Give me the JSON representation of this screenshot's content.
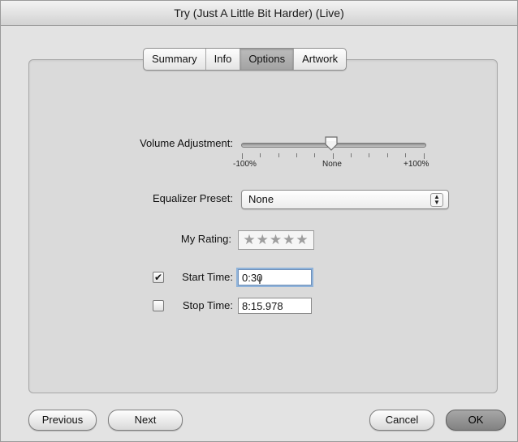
{
  "window": {
    "title": "Try (Just A Little Bit Harder) (Live)"
  },
  "tabs": [
    {
      "label": "Summary",
      "active": false
    },
    {
      "label": "Info",
      "active": false
    },
    {
      "label": "Options",
      "active": true
    },
    {
      "label": "Artwork",
      "active": false
    }
  ],
  "options": {
    "volume": {
      "label": "Volume Adjustment:",
      "value_percent": 0,
      "tick_min": "-100%",
      "tick_mid": "None",
      "tick_max": "+100%"
    },
    "equalizer": {
      "label": "Equalizer Preset:",
      "value": "None"
    },
    "rating": {
      "label": "My Rating:",
      "stars_display": "★★★★★",
      "value": 0
    },
    "start_time": {
      "label": "Start Time:",
      "checked": true,
      "check_mark": "✔",
      "value": "0:30"
    },
    "stop_time": {
      "label": "Stop Time:",
      "checked": false,
      "value": "8:15.978"
    }
  },
  "buttons": {
    "previous": "Previous",
    "next": "Next",
    "cancel": "Cancel",
    "ok": "OK"
  }
}
